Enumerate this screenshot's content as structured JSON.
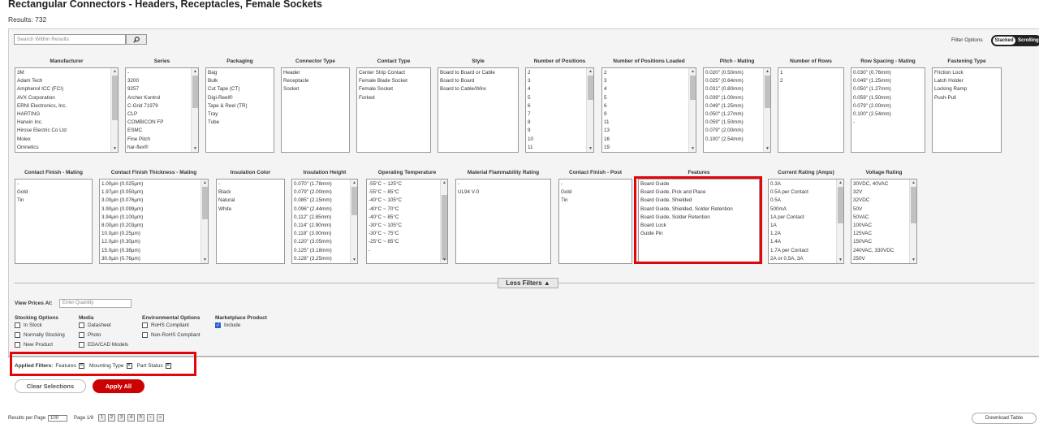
{
  "header": {
    "title": "Rectangular Connectors - Headers, Receptacles, Female Sockets",
    "results_label": "Results:",
    "results_count": "732"
  },
  "search": {
    "placeholder": "Search Within Results"
  },
  "filter_options": {
    "label": "Filter Options",
    "stacked": "Stacked",
    "scrolling": "Scrolling"
  },
  "filters_row1": [
    {
      "name": "Manufacturer",
      "items": [
        "3M",
        "Adam Tech",
        "Amphenol ICC (FCI)",
        "AVX Corporation",
        "ERNI Electronics, Inc.",
        "HARTING",
        "Harwin Inc.",
        "Hirose Electric Co Ltd",
        "Molex",
        "Omnetics"
      ]
    },
    {
      "name": "Series",
      "items": [
        "-",
        "3200",
        "9257",
        "Archer Kontrol",
        "C-Grid 71979",
        "CLP",
        "COMBICON FP",
        "ESMC",
        "Fine Pitch",
        "har-flex®"
      ]
    },
    {
      "name": "Packaging",
      "items": [
        "Bag",
        "Bulk",
        "Cut Tape (CT)",
        "Digi-Reel®",
        "Tape & Reel (TR)",
        "Tray",
        "Tube"
      ]
    },
    {
      "name": "Connector Type",
      "items": [
        "Header",
        "Receptacle",
        "Socket"
      ]
    },
    {
      "name": "Contact Type",
      "items": [
        "Center Strip Contact",
        "Female Blade Socket",
        "Female Socket",
        "Forked"
      ]
    },
    {
      "name": "Style",
      "items": [
        "Board to Board or Cable",
        "Board to Board",
        "Board to Cable/Wire"
      ]
    },
    {
      "name": "Number of Positions",
      "items": [
        "2",
        "3",
        "4",
        "5",
        "6",
        "7",
        "8",
        "9",
        "10",
        "11"
      ]
    },
    {
      "name": "Number of Positions Loaded",
      "items": [
        "2",
        "3",
        "4",
        "5",
        "6",
        "9",
        "11",
        "13",
        "16",
        "19"
      ]
    },
    {
      "name": "Pitch - Mating",
      "items": [
        "0.020\" (0.50mm)",
        "0.025\" (0.64mm)",
        "0.031\" (0.80mm)",
        "0.039\" (1.00mm)",
        "0.049\" (1.25mm)",
        "0.050\" (1.27mm)",
        "0.059\" (1.50mm)",
        "0.079\" (2.00mm)",
        "0.100\" (2.54mm)"
      ]
    },
    {
      "name": "Number of Rows",
      "items": [
        "1",
        "2"
      ]
    },
    {
      "name": "Row Spacing - Mating",
      "items": [
        "0.030\" (0.76mm)",
        "0.049\" (1.25mm)",
        "0.050\" (1.27mm)",
        "0.059\" (1.50mm)",
        "0.079\" (2.00mm)",
        "0.100\" (2.54mm)",
        "-"
      ]
    },
    {
      "name": "Fastening Type",
      "items": [
        "Friction Lock",
        "Latch Holder",
        "Locking Ramp",
        "Push-Pull"
      ]
    }
  ],
  "filters_row2": [
    {
      "name": "Contact Finish - Mating",
      "items": [
        "-",
        "Gold",
        "Tin"
      ]
    },
    {
      "name": "Contact Finish Thickness - Mating",
      "items": [
        "1.00µin (0.025µm)",
        "1.97µin (0.050µm)",
        "3.00µin (0.076µm)",
        "3.90µin (0.099µm)",
        "3.94µin (0.100µm)",
        "8.00µin (0.203µm)",
        "10.0µin (0.25µm)",
        "12.0µin (0.30µm)",
        "15.0µin (0.38µm)",
        "30.0µin (0.76µm)"
      ]
    },
    {
      "name": "Insulation Color",
      "items": [
        "-",
        "Black",
        "Natural",
        "White"
      ]
    },
    {
      "name": "Insulation Height",
      "items": [
        "0.070\" (1.78mm)",
        "0.079\" (2.00mm)",
        "0.085\" (2.15mm)",
        "0.096\" (2.44mm)",
        "0.112\" (2.85mm)",
        "0.114\" (2.90mm)",
        "0.118\" (3.00mm)",
        "0.120\" (3.05mm)",
        "0.125\" (3.18mm)",
        "0.128\" (3.25mm)"
      ]
    },
    {
      "name": "Operating Temperature",
      "items": [
        "-55°C ~ 125°C",
        "-55°C ~ 85°C",
        "-40°C ~ 105°C",
        "-40°C ~ 70°C",
        "-40°C ~ 85°C",
        "-30°C ~ 105°C",
        "-30°C ~ 75°C",
        "-25°C ~ 85°C",
        "-"
      ]
    },
    {
      "name": "Material Flammability Rating",
      "items": [
        "-",
        "UL94 V-0"
      ]
    },
    {
      "name": "Contact Finish - Post",
      "items": [
        "-",
        "Gold",
        "Tin"
      ]
    },
    {
      "name": "Features",
      "items": [
        "Board Guide",
        "Board Guide, Pick and Place",
        "Board Guide, Shielded",
        "Board Guide, Shielded, Solder Retention",
        "Board Guide, Solder Retention",
        "Board Lock",
        "Guide Pin"
      ]
    },
    {
      "name": "Current Rating (Amps)",
      "items": [
        "0.3A",
        "0.5A per Contact",
        "0.5A",
        "500mA",
        "1A per Contact",
        "1A",
        "1.2A",
        "1.4A",
        "1.7A per Contact",
        "2A or 0.5A, 3A"
      ]
    },
    {
      "name": "Voltage Rating",
      "items": [
        "30VDC, 40VAC",
        "32V",
        "32VDC",
        "50V",
        "50VAC",
        "100VAC",
        "125VAC",
        "150VAC",
        "240VAC, 330VDC",
        "250V"
      ]
    }
  ],
  "less_filters": "Less Filters",
  "view_prices": {
    "label": "View Prices At:",
    "placeholder": "Enter Quantity"
  },
  "options": {
    "stocking": {
      "title": "Stocking Options",
      "items": [
        "In Stock",
        "Normally Stocking",
        "New Product"
      ]
    },
    "media": {
      "title": "Media",
      "items": [
        "Datasheet",
        "Photo",
        "EDA/CAD Models"
      ]
    },
    "environmental": {
      "title": "Environmental Options",
      "items": [
        "RoHS Compliant",
        "Non-RoHS Compliant"
      ]
    },
    "marketplace": {
      "title": "Marketplace Product",
      "items": [
        "Include"
      ]
    }
  },
  "applied": {
    "label": "Applied Filters:",
    "chips": [
      "Features",
      "Mounting Type",
      "Part Status"
    ]
  },
  "buttons": {
    "clear": "Clear Selections",
    "apply": "Apply All"
  },
  "footer": {
    "per_page_label": "Results per Page",
    "per_page": "100",
    "page_label": "Page 1/8",
    "pages": [
      "1",
      "2",
      "3",
      "4",
      "5"
    ],
    "download": "Download Table"
  },
  "colors": {
    "highlight": "#e0060b",
    "apply": "#cc0000",
    "checkbox": "#2b64c5"
  }
}
